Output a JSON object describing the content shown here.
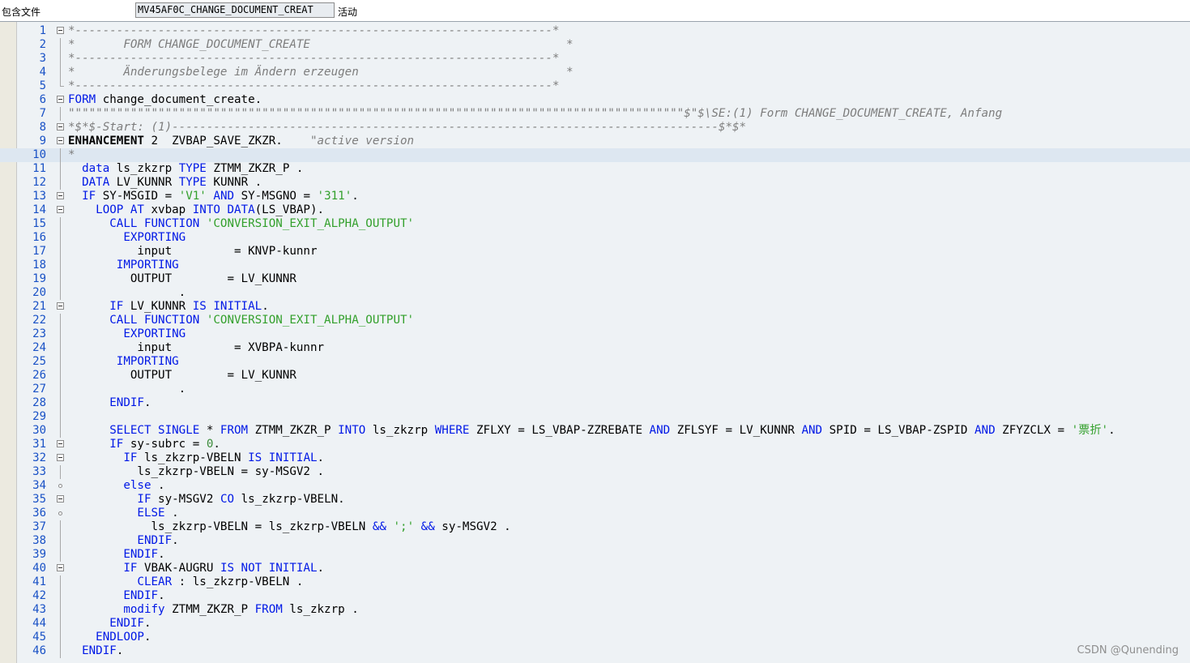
{
  "header": {
    "label": "包含文件",
    "object_name": "MV45AF0C_CHANGE_DOCUMENT_CREAT",
    "status": "活动"
  },
  "watermark": "CSDN @Qunending",
  "lines": [
    {
      "n": "1",
      "fold": "box",
      "tokens": [
        [
          "c",
          "*---------------------------------------------------------------------*"
        ]
      ]
    },
    {
      "n": "2",
      "fold": "line",
      "tokens": [
        [
          "c",
          "*       FORM CHANGE_DOCUMENT_CREATE                                     *"
        ]
      ]
    },
    {
      "n": "3",
      "fold": "line",
      "tokens": [
        [
          "c",
          "*---------------------------------------------------------------------*"
        ]
      ]
    },
    {
      "n": "4",
      "fold": "line",
      "tokens": [
        [
          "c",
          "*       Änderungsbelege im Ändern erzeugen                              *"
        ]
      ]
    },
    {
      "n": "5",
      "fold": "end",
      "tokens": [
        [
          "c",
          "*---------------------------------------------------------------------*"
        ]
      ]
    },
    {
      "n": "6",
      "fold": "box",
      "tokens": [
        [
          "k",
          "FORM"
        ],
        [
          "t",
          " change_document_create."
        ]
      ]
    },
    {
      "n": "7",
      "fold": "line",
      "tokens": [
        [
          "c",
          "\"\"\"\"\"\"\"\"\"\"\"\"\"\"\"\"\"\"\"\"\"\"\"\"\"\"\"\"\"\"\"\"\"\"\"\"\"\"\"\"\"\"\"\"\"\"\"\"\"\"\"\"\"\"\"\"\"\"\"\"\"\"\"\"\"\"\"\"\"\"\"\"\"\"\"\"\"\"\"\"\"\"\"\"\"\"\"\"\"$\"$\\SE:(1) Form CHANGE_DOCUMENT_CREATE, Anfang"
        ]
      ]
    },
    {
      "n": "8",
      "fold": "box",
      "tokens": [
        [
          "c",
          "*$*$-Start: (1)-------------------------------------------------------------------------------$*$*"
        ]
      ]
    },
    {
      "n": "9",
      "fold": "box",
      "tokens": [
        [
          "b",
          "ENHANCEMENT"
        ],
        [
          "t",
          " 2  ZVBAP_SAVE_ZKZR.    "
        ],
        [
          "c",
          "\"active version"
        ]
      ]
    },
    {
      "n": "10",
      "fold": "line",
      "cur": true,
      "tokens": [
        [
          "c",
          "*"
        ]
      ]
    },
    {
      "n": "11",
      "fold": "line",
      "tokens": [
        [
          "t",
          "  "
        ],
        [
          "k",
          "data"
        ],
        [
          "t",
          " ls_zkzrp "
        ],
        [
          "k",
          "TYPE"
        ],
        [
          "t",
          " ZTMM_ZKZR_P ."
        ]
      ]
    },
    {
      "n": "12",
      "fold": "line",
      "tokens": [
        [
          "t",
          "  "
        ],
        [
          "k",
          "DATA"
        ],
        [
          "t",
          " LV_KUNNR "
        ],
        [
          "k",
          "TYPE"
        ],
        [
          "t",
          " KUNNR ."
        ]
      ]
    },
    {
      "n": "13",
      "fold": "box",
      "tokens": [
        [
          "t",
          "  "
        ],
        [
          "k",
          "IF"
        ],
        [
          "t",
          " SY-MSGID = "
        ],
        [
          "s",
          "'V1'"
        ],
        [
          "t",
          " "
        ],
        [
          "k",
          "AND"
        ],
        [
          "t",
          " SY-MSGNO = "
        ],
        [
          "s",
          "'311'"
        ],
        [
          "t",
          "."
        ]
      ]
    },
    {
      "n": "14",
      "fold": "box",
      "tokens": [
        [
          "t",
          "    "
        ],
        [
          "k",
          "LOOP AT"
        ],
        [
          "t",
          " xvbap "
        ],
        [
          "k",
          "INTO DATA"
        ],
        [
          "t",
          "(LS_VBAP)."
        ]
      ]
    },
    {
      "n": "15",
      "fold": "line",
      "tokens": [
        [
          "t",
          "      "
        ],
        [
          "k",
          "CALL FUNCTION"
        ],
        [
          "t",
          " "
        ],
        [
          "s",
          "'CONVERSION_EXIT_ALPHA_OUTPUT'"
        ]
      ]
    },
    {
      "n": "16",
      "fold": "line",
      "tokens": [
        [
          "t",
          "        "
        ],
        [
          "k",
          "EXPORTING"
        ]
      ]
    },
    {
      "n": "17",
      "fold": "line",
      "tokens": [
        [
          "t",
          "          input         = KNVP-kunnr"
        ]
      ]
    },
    {
      "n": "18",
      "fold": "line",
      "tokens": [
        [
          "t",
          "       "
        ],
        [
          "k",
          "IMPORTING"
        ]
      ]
    },
    {
      "n": "19",
      "fold": "line",
      "tokens": [
        [
          "t",
          "         OUTPUT        = LV_KUNNR"
        ]
      ]
    },
    {
      "n": "20",
      "fold": "line",
      "tokens": [
        [
          "t",
          "                ."
        ]
      ]
    },
    {
      "n": "21",
      "fold": "box",
      "tokens": [
        [
          "t",
          "      "
        ],
        [
          "k",
          "IF"
        ],
        [
          "t",
          " LV_KUNNR "
        ],
        [
          "k",
          "IS INITIAL"
        ],
        [
          "t",
          "."
        ]
      ]
    },
    {
      "n": "22",
      "fold": "line",
      "tokens": [
        [
          "t",
          "      "
        ],
        [
          "k",
          "CALL FUNCTION"
        ],
        [
          "t",
          " "
        ],
        [
          "s",
          "'CONVERSION_EXIT_ALPHA_OUTPUT'"
        ]
      ]
    },
    {
      "n": "23",
      "fold": "line",
      "tokens": [
        [
          "t",
          "        "
        ],
        [
          "k",
          "EXPORTING"
        ]
      ]
    },
    {
      "n": "24",
      "fold": "line",
      "tokens": [
        [
          "t",
          "          input         = XVBPA-kunnr"
        ]
      ]
    },
    {
      "n": "25",
      "fold": "line",
      "tokens": [
        [
          "t",
          "       "
        ],
        [
          "k",
          "IMPORTING"
        ]
      ]
    },
    {
      "n": "26",
      "fold": "line",
      "tokens": [
        [
          "t",
          "         OUTPUT        = LV_KUNNR"
        ]
      ]
    },
    {
      "n": "27",
      "fold": "line",
      "tokens": [
        [
          "t",
          "                ."
        ]
      ]
    },
    {
      "n": "28",
      "fold": "line",
      "tokens": [
        [
          "t",
          "      "
        ],
        [
          "k",
          "ENDIF"
        ],
        [
          "t",
          "."
        ]
      ]
    },
    {
      "n": "29",
      "fold": "line",
      "tokens": [
        [
          "t",
          ""
        ]
      ]
    },
    {
      "n": "30",
      "fold": "line",
      "tokens": [
        [
          "t",
          "      "
        ],
        [
          "k",
          "SELECT SINGLE"
        ],
        [
          "t",
          " * "
        ],
        [
          "k",
          "FROM"
        ],
        [
          "t",
          " ZTMM_ZKZR_P "
        ],
        [
          "k",
          "INTO"
        ],
        [
          "t",
          " ls_zkzrp "
        ],
        [
          "k",
          "WHERE"
        ],
        [
          "t",
          " ZFLXY = LS_VBAP-ZZREBATE "
        ],
        [
          "k",
          "AND"
        ],
        [
          "t",
          " ZFLSYF = LV_KUNNR "
        ],
        [
          "k",
          "AND"
        ],
        [
          "t",
          " SPID = LS_VBAP-ZSPID "
        ],
        [
          "k",
          "AND"
        ],
        [
          "t",
          " ZFYZCLX = "
        ],
        [
          "s",
          "'票折'"
        ],
        [
          "t",
          "."
        ]
      ]
    },
    {
      "n": "31",
      "fold": "box",
      "tokens": [
        [
          "t",
          "      "
        ],
        [
          "k",
          "IF"
        ],
        [
          "t",
          " sy-subrc = "
        ],
        [
          "n",
          "0"
        ],
        [
          "t",
          "."
        ]
      ]
    },
    {
      "n": "32",
      "fold": "box",
      "tokens": [
        [
          "t",
          "        "
        ],
        [
          "k",
          "IF"
        ],
        [
          "t",
          " ls_zkzrp-VBELN "
        ],
        [
          "k",
          "IS INITIAL"
        ],
        [
          "t",
          "."
        ]
      ]
    },
    {
      "n": "33",
      "fold": "line",
      "tokens": [
        [
          "t",
          "          ls_zkzrp-VBELN = sy-MSGV2 ."
        ]
      ]
    },
    {
      "n": "34",
      "fold": "dot",
      "tokens": [
        [
          "t",
          "        "
        ],
        [
          "k",
          "else"
        ],
        [
          "t",
          " ."
        ]
      ]
    },
    {
      "n": "35",
      "fold": "box",
      "tokens": [
        [
          "t",
          "          "
        ],
        [
          "k",
          "IF"
        ],
        [
          "t",
          " sy-MSGV2 "
        ],
        [
          "k",
          "CO"
        ],
        [
          "t",
          " ls_zkzrp-VBELN."
        ]
      ]
    },
    {
      "n": "36",
      "fold": "dot",
      "tokens": [
        [
          "t",
          "          "
        ],
        [
          "k",
          "ELSE"
        ],
        [
          "t",
          " ."
        ]
      ]
    },
    {
      "n": "37",
      "fold": "line",
      "tokens": [
        [
          "t",
          "            ls_zkzrp-VBELN = ls_zkzrp-VBELN "
        ],
        [
          "k",
          "&&"
        ],
        [
          "t",
          " "
        ],
        [
          "s",
          "';'"
        ],
        [
          "t",
          " "
        ],
        [
          "k",
          "&&"
        ],
        [
          "t",
          " sy-MSGV2 ."
        ]
      ]
    },
    {
      "n": "38",
      "fold": "line",
      "tokens": [
        [
          "t",
          "          "
        ],
        [
          "k",
          "ENDIF"
        ],
        [
          "t",
          "."
        ]
      ]
    },
    {
      "n": "39",
      "fold": "line",
      "tokens": [
        [
          "t",
          "        "
        ],
        [
          "k",
          "ENDIF"
        ],
        [
          "t",
          "."
        ]
      ]
    },
    {
      "n": "40",
      "fold": "box",
      "tokens": [
        [
          "t",
          "        "
        ],
        [
          "k",
          "IF"
        ],
        [
          "t",
          " VBAK-AUGRU "
        ],
        [
          "k",
          "IS NOT INITIAL"
        ],
        [
          "t",
          "."
        ]
      ]
    },
    {
      "n": "41",
      "fold": "line",
      "tokens": [
        [
          "t",
          "          "
        ],
        [
          "k",
          "CLEAR"
        ],
        [
          "t",
          " : ls_zkzrp-VBELN ."
        ]
      ]
    },
    {
      "n": "42",
      "fold": "line",
      "tokens": [
        [
          "t",
          "        "
        ],
        [
          "k",
          "ENDIF"
        ],
        [
          "t",
          "."
        ]
      ]
    },
    {
      "n": "43",
      "fold": "line",
      "tokens": [
        [
          "t",
          "        "
        ],
        [
          "k",
          "modify"
        ],
        [
          "t",
          " ZTMM_ZKZR_P "
        ],
        [
          "k",
          "FROM"
        ],
        [
          "t",
          " ls_zkzrp ."
        ]
      ]
    },
    {
      "n": "44",
      "fold": "line",
      "tokens": [
        [
          "t",
          "      "
        ],
        [
          "k",
          "ENDIF"
        ],
        [
          "t",
          "."
        ]
      ]
    },
    {
      "n": "45",
      "fold": "line",
      "tokens": [
        [
          "t",
          "    "
        ],
        [
          "k",
          "ENDLOOP"
        ],
        [
          "t",
          "."
        ]
      ]
    },
    {
      "n": "46",
      "fold": "line",
      "tokens": [
        [
          "t",
          "  "
        ],
        [
          "k",
          "ENDIF"
        ],
        [
          "t",
          "."
        ]
      ]
    }
  ]
}
